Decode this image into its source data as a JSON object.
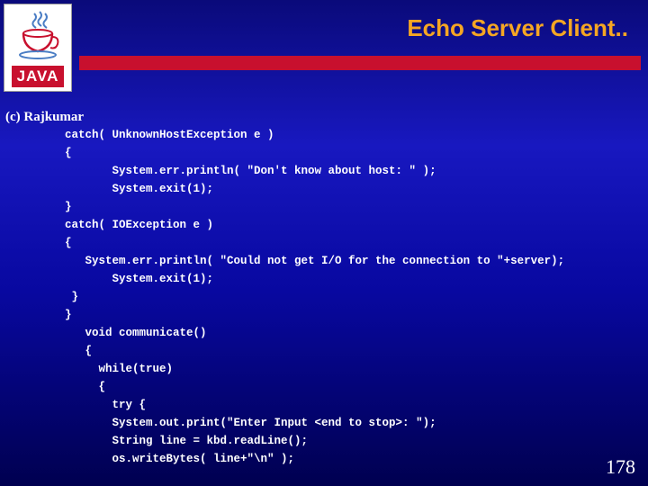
{
  "logo": {
    "cup_color": "#c8102e",
    "steam_color": "#4a7dc4",
    "label": "JAVA"
  },
  "header": {
    "title": "Echo Server Client..",
    "bar_color": "#c8102e"
  },
  "copyright": "(c) Rajkumar",
  "code": {
    "lines": [
      "catch( UnknownHostException e )",
      "{",
      "       System.err.println( \"Don't know about host: \" );",
      "       System.exit(1);",
      "}",
      "catch( IOException e )",
      "{",
      "   System.err.println( \"Could not get I/O for the connection to \"+server);",
      "       System.exit(1);",
      " }",
      "}",
      "   void communicate()",
      "   {",
      "     while(true)",
      "     {",
      "       try {",
      "       System.out.print(\"Enter Input <end to stop>: \");",
      "       String line = kbd.readLine();",
      "       os.writeBytes( line+\"\\n\" );"
    ]
  },
  "page_number": "178"
}
